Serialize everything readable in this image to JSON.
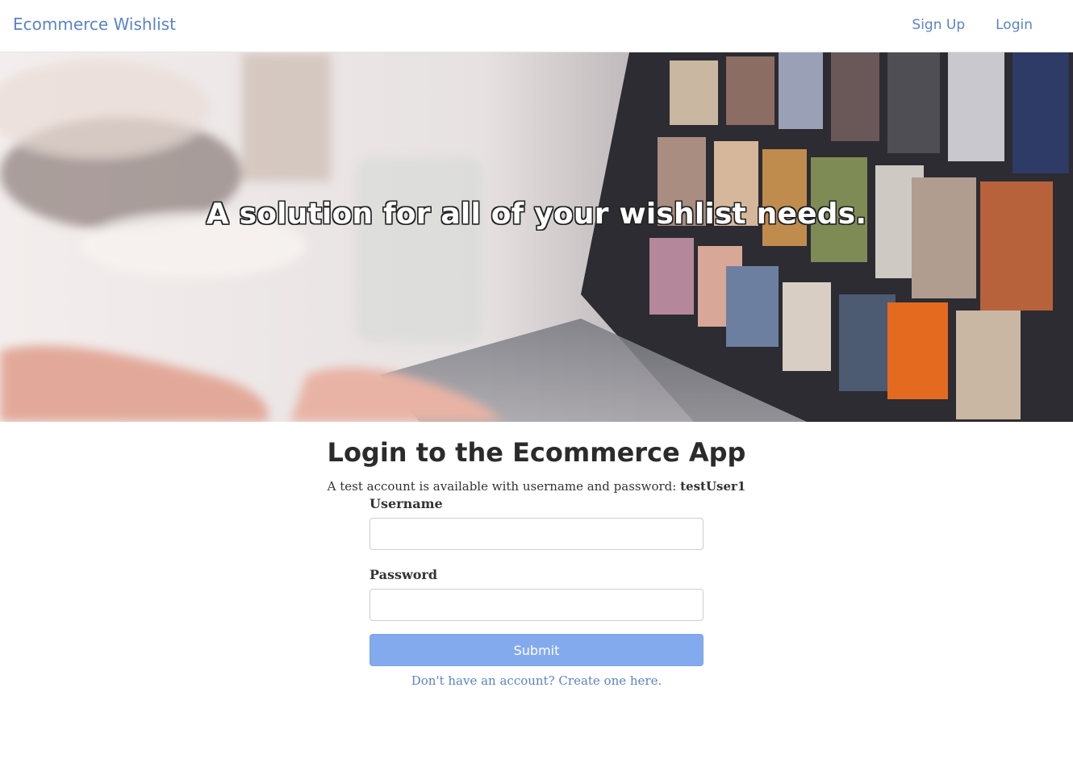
{
  "navbar": {
    "brand": "Ecommerce Wishlist",
    "links": [
      {
        "label": "Sign Up"
      },
      {
        "label": "Login"
      }
    ]
  },
  "hero": {
    "tagline": "A solution for all of your wishlist needs."
  },
  "login": {
    "title": "Login to the Ecommerce App",
    "note_prefix": "A test account is available with username and password: ",
    "note_account": "testUser1",
    "username_label": "Username",
    "username_value": "",
    "password_label": "Password",
    "password_value": "",
    "submit_label": "Submit",
    "signup_prompt": "Don't have an account? Create one here."
  },
  "colors": {
    "link": "#5b84c4",
    "submit_bg": "#84aaee",
    "heading": "#2b2b2b"
  }
}
